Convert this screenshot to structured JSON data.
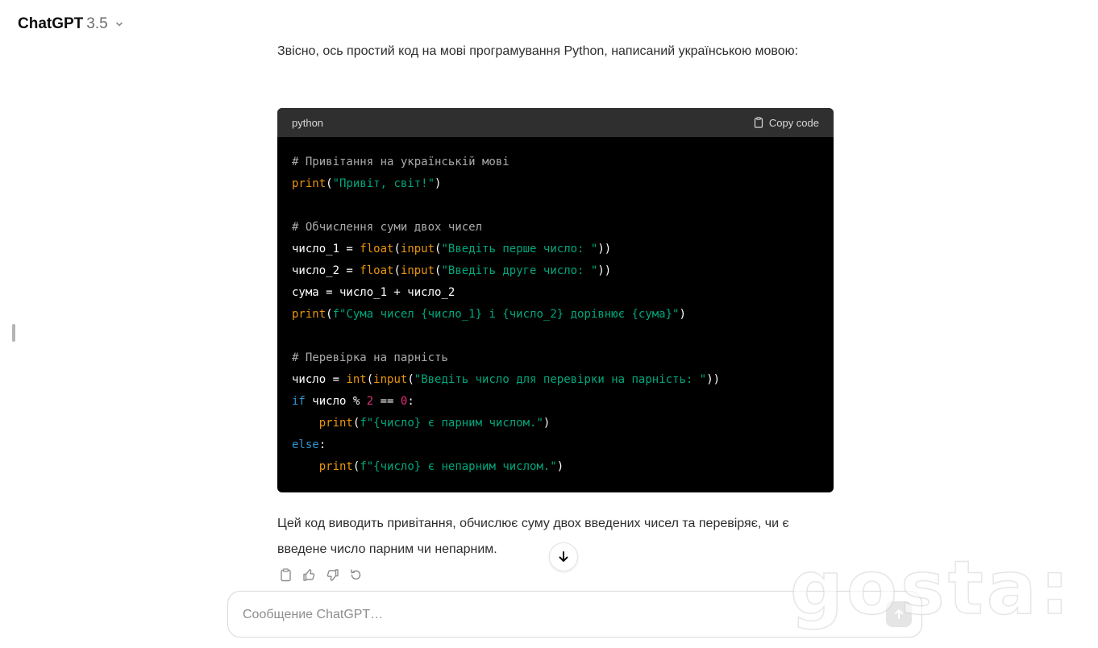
{
  "header": {
    "title": "ChatGPT",
    "version": "3.5",
    "icon": "chevron-down-icon"
  },
  "messages": {
    "intro": "Звісно, ось простий код на мові програмування Python, написаний українською мовою:",
    "outro": "Цей код виводить привітання, обчислює суму двох введених чисел та перевіряє, чи є введене число парним чи непарним."
  },
  "code_block": {
    "language": "python",
    "copy_label": "Copy code",
    "lines": {
      "l1": "# Привітання на українській мові",
      "l2": [
        "print",
        "(",
        "\"Привіт, світ!\"",
        ")"
      ],
      "l4": "# Обчислення суми двох чисел",
      "l5": [
        "число_1 = ",
        "float",
        "(",
        "input",
        "(",
        "\"Введіть перше число: \"",
        "))"
      ],
      "l6": [
        "число_2 = ",
        "float",
        "(",
        "input",
        "(",
        "\"Введіть друге число: \"",
        "))"
      ],
      "l7": "сума = число_1 + число_2",
      "l8": [
        "print",
        "(",
        "f\"Сума чисел {число_1} і {число_2} дорівнює {сума}\"",
        ")"
      ],
      "l10": "# Перевірка на парність",
      "l11": [
        "число = ",
        "int",
        "(",
        "input",
        "(",
        "\"Введіть число для перевірки на парність: \"",
        "))"
      ],
      "l12": [
        "if",
        " число % ",
        "2",
        " == ",
        "0",
        ":"
      ],
      "l13": [
        "    ",
        "print",
        "(",
        "f\"{число} є парним числом.\"",
        ")"
      ],
      "l14": [
        "else",
        ":"
      ],
      "l15": [
        "    ",
        "print",
        "(",
        "f\"{число} є непарним числом.\"",
        ")"
      ]
    },
    "colors": {
      "comment": "#aaaaaa",
      "function": "#e9950c",
      "string": "#00a67d",
      "keyword": "#2e95d3",
      "number": "#df3079"
    }
  },
  "actions": {
    "icons": [
      "clipboard-icon",
      "thumbs-up-icon",
      "thumbs-down-icon",
      "regenerate-icon"
    ]
  },
  "composer": {
    "placeholder": "Сообщение ChatGPT…"
  },
  "watermark": "gosta:"
}
